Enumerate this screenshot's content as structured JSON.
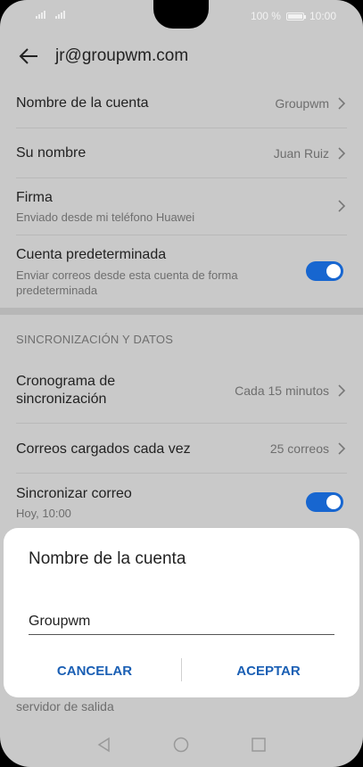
{
  "status": {
    "left": "",
    "battery_text": "100 %",
    "time": "10:00",
    "battery_level": 1.0
  },
  "header": {
    "title": "jr@groupwm.com",
    "back_icon": "arrow-left-icon"
  },
  "settings": {
    "account_name": {
      "label": "Nombre de la cuenta",
      "value": "Groupwm"
    },
    "your_name": {
      "label": "Su nombre",
      "value": "Juan Ruiz"
    },
    "signature": {
      "label": "Firma",
      "sub": "Enviado desde mi teléfono Huawei"
    },
    "default_account": {
      "label": "Cuenta predeterminada",
      "sub": "Enviar correos desde esta cuenta de forma predeterminada",
      "on": true
    },
    "section_title": "SINCRONIZACIÓN Y DATOS",
    "sync_schedule": {
      "label": "Cronograma de sincronización",
      "value": "Cada 15 minutos"
    },
    "mails_loaded": {
      "label": "Correos cargados cada vez",
      "value": "25 correos"
    },
    "sync_mail": {
      "label": "Sincronizar correo",
      "sub": "Hoy, 10:00",
      "on": true
    },
    "bottom_text": "servidor de salida"
  },
  "dialog": {
    "title": "Nombre de la cuenta",
    "input_value": "Groupwm",
    "cancel_label": "CANCELAR",
    "accept_label": "ACEPTAR"
  },
  "colors": {
    "accent": "#1766d0",
    "button_text": "#1a5fb4",
    "background": "#c9c9c9"
  }
}
